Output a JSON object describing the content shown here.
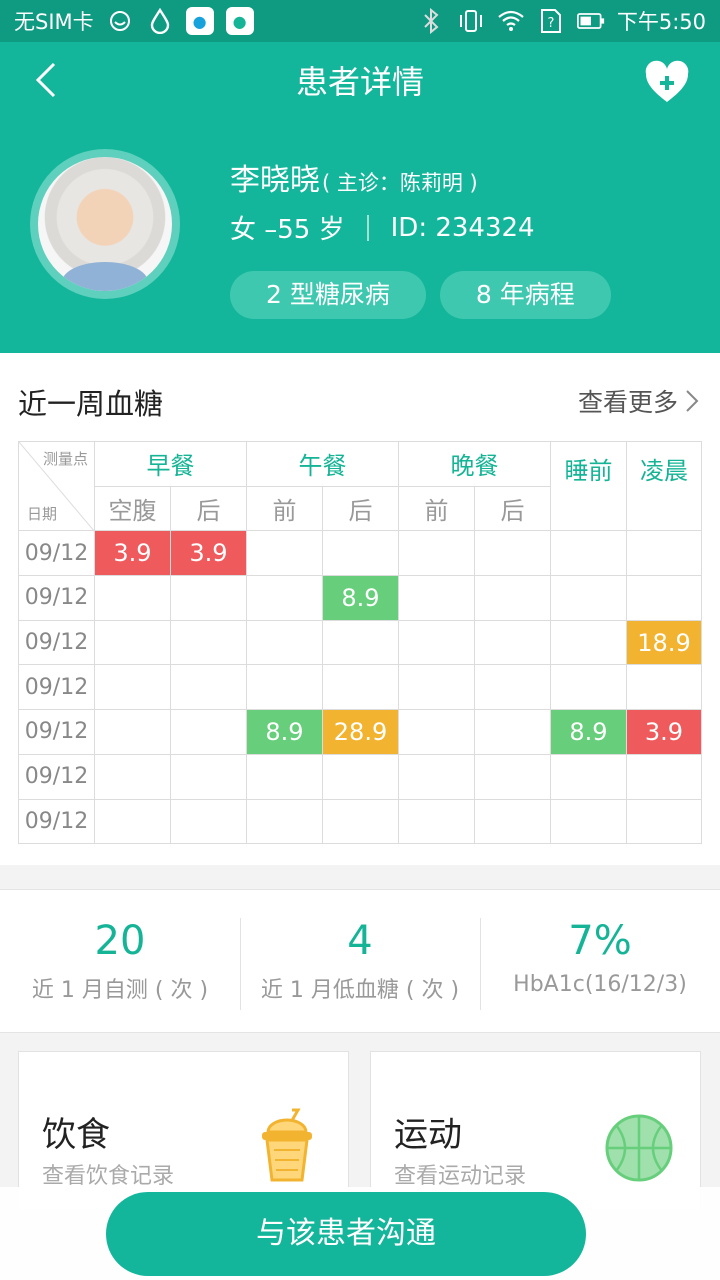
{
  "status_bar": {
    "carrier": "无SIM卡",
    "time": "下午5:50"
  },
  "nav": {
    "title": "患者详情"
  },
  "patient": {
    "name": "李晓晓",
    "doctor": "( 主诊：陈莉明 )",
    "gender_age": "女 –55 岁",
    "id": "ID: 234324",
    "tags": [
      "2 型糖尿病",
      "8 年病程"
    ]
  },
  "glucose": {
    "title": "近一周血糖",
    "more": "查看更多",
    "corner_top": "测量点",
    "corner_bottom": "日期",
    "meals": [
      "早餐",
      "午餐",
      "晚餐",
      "睡前",
      "凌晨"
    ],
    "subs": [
      "空腹",
      "后",
      "前",
      "后",
      "前",
      "后"
    ],
    "rows": [
      {
        "date": "09/12",
        "cells": [
          "3.9",
          "3.9",
          "",
          "",
          "",
          "",
          "",
          ""
        ]
      },
      {
        "date": "09/12",
        "cells": [
          "",
          "",
          "",
          "8.9",
          "",
          "",
          "",
          ""
        ]
      },
      {
        "date": "09/12",
        "cells": [
          "",
          "",
          "",
          "",
          "",
          "",
          "",
          "18.9"
        ]
      },
      {
        "date": "09/12",
        "cells": [
          "",
          "",
          "",
          "",
          "",
          "",
          "",
          ""
        ]
      },
      {
        "date": "09/12",
        "cells": [
          "",
          "",
          "8.9",
          "28.9",
          "",
          "",
          "8.9",
          "3.9"
        ]
      },
      {
        "date": "09/12",
        "cells": [
          "",
          "",
          "",
          "",
          "",
          "",
          "",
          ""
        ]
      },
      {
        "date": "09/12",
        "cells": [
          "",
          "",
          "",
          "",
          "",
          "",
          "",
          ""
        ]
      }
    ],
    "status_colors": {
      "low": "#ef5a5d",
      "normal": "#67cf7b",
      "high": "#f2b430"
    },
    "cell_status": [
      [
        "low",
        "low",
        "",
        "",
        "",
        "",
        "",
        ""
      ],
      [
        "",
        "",
        "",
        "normal",
        "",
        "",
        "",
        ""
      ],
      [
        "",
        "",
        "",
        "",
        "",
        "",
        "",
        "high"
      ],
      [
        "",
        "",
        "",
        "",
        "",
        "",
        "",
        ""
      ],
      [
        "",
        "",
        "normal",
        "high",
        "",
        "",
        "normal",
        "low"
      ],
      [
        "",
        "",
        "",
        "",
        "",
        "",
        "",
        ""
      ],
      [
        "",
        "",
        "",
        "",
        "",
        "",
        "",
        ""
      ]
    ]
  },
  "stats": [
    {
      "value": "20",
      "label": "近 1 月自测 ( 次 )"
    },
    {
      "value": "4",
      "label": "近 1 月低血糖 ( 次 )"
    },
    {
      "value": "7%",
      "label": "HbA1c(16/12/3)"
    }
  ],
  "cards": {
    "diet": {
      "title": "饮食",
      "subtitle": "查看饮食记录",
      "icon": "drink-cup-icon"
    },
    "sport": {
      "title": "运动",
      "subtitle": "查看运动记录",
      "icon": "basketball-icon"
    }
  },
  "cta": {
    "label": "与该患者沟通"
  },
  "colors": {
    "primary": "#14b69b",
    "status_bar": "#0f9a82"
  }
}
